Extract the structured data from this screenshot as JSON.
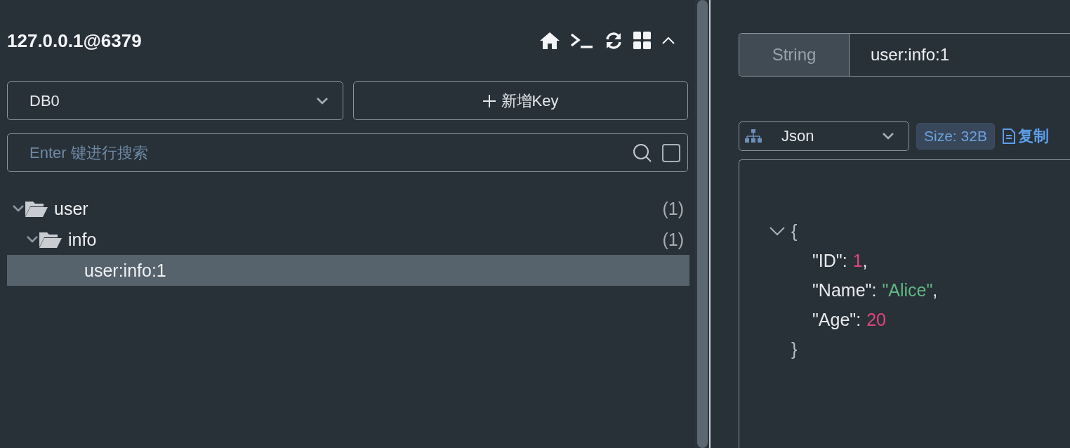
{
  "connection": {
    "title": "127.0.0.1@6379"
  },
  "db_select": {
    "value": "DB0"
  },
  "add_key_button": {
    "label": "新增Key"
  },
  "search": {
    "placeholder": "Enter 键进行搜索",
    "checked": false
  },
  "tree": [
    {
      "label": "user",
      "count": "(1)",
      "expanded": true,
      "selected": false,
      "children": [
        {
          "label": "info",
          "count": "(1)",
          "expanded": true,
          "selected": false,
          "children": [
            {
              "label": "user:info:1",
              "selected": true
            }
          ]
        }
      ]
    }
  ],
  "key_header": {
    "type": "String",
    "key": "user:info:1"
  },
  "viewer": {
    "format": "Json",
    "size": "Size: 32B",
    "copy_label": "复制"
  },
  "json_view": {
    "expanded": true,
    "open": "{",
    "close": "}",
    "entries": [
      {
        "key": "\"ID\":",
        "value": "1",
        "kind": "number",
        "separator": ","
      },
      {
        "key": "\"Name\":",
        "value": "\"Alice\"",
        "kind": "string",
        "separator": ","
      },
      {
        "key": "\"Age\":",
        "value": "20",
        "kind": "number"
      }
    ]
  }
}
